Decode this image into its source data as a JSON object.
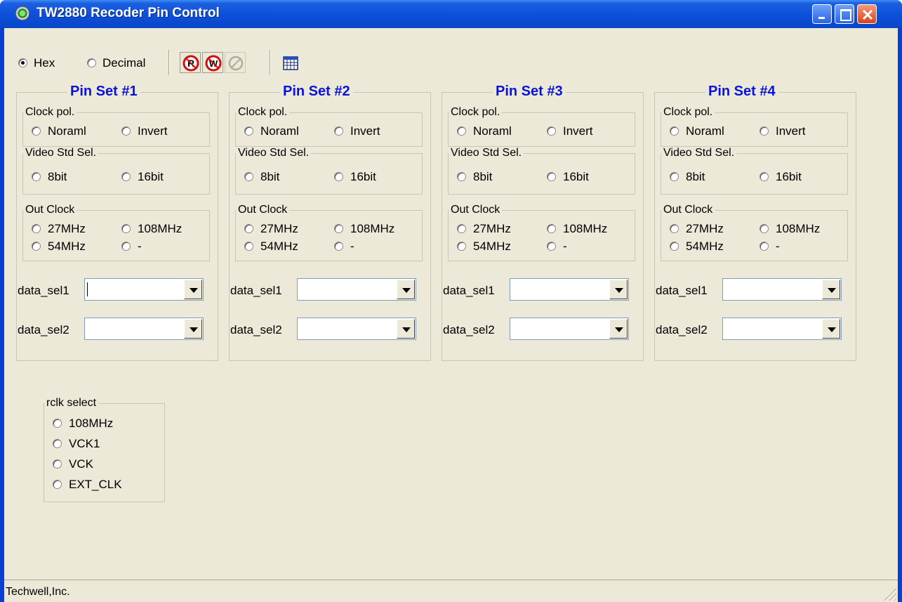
{
  "window": {
    "title": "TW2880 Recoder Pin Control"
  },
  "toolbar": {
    "radios": [
      {
        "label": "Hex",
        "checked": true
      },
      {
        "label": "Decimal",
        "checked": false
      }
    ],
    "buttons": [
      "read-icon",
      "write-icon",
      "disabled-icon",
      "table-icon"
    ]
  },
  "pinsets": [
    {
      "title": "Pin Set #1",
      "clock_pol": {
        "legend": "Clock pol.",
        "options": [
          "Noraml",
          "Invert"
        ]
      },
      "video_std": {
        "legend": "Video Std Sel.",
        "options": [
          "8bit",
          "16bit"
        ]
      },
      "out_clock": {
        "legend": "Out Clock",
        "options": [
          "27MHz",
          "108MHz",
          "54MHz",
          "-"
        ]
      },
      "data_sel1": {
        "label": "data_sel1",
        "value": ""
      },
      "data_sel2": {
        "label": "data_sel2",
        "value": ""
      }
    },
    {
      "title": "Pin Set #2",
      "clock_pol": {
        "legend": "Clock pol.",
        "options": [
          "Noraml",
          "Invert"
        ]
      },
      "video_std": {
        "legend": "Video Std Sel.",
        "options": [
          "8bit",
          "16bit"
        ]
      },
      "out_clock": {
        "legend": "Out Clock",
        "options": [
          "27MHz",
          "108MHz",
          "54MHz",
          "-"
        ]
      },
      "data_sel1": {
        "label": "data_sel1",
        "value": ""
      },
      "data_sel2": {
        "label": "data_sel2",
        "value": ""
      }
    },
    {
      "title": "Pin Set #3",
      "clock_pol": {
        "legend": "Clock pol.",
        "options": [
          "Noraml",
          "Invert"
        ]
      },
      "video_std": {
        "legend": "Video Std Sel.",
        "options": [
          "8bit",
          "16bit"
        ]
      },
      "out_clock": {
        "legend": "Out Clock",
        "options": [
          "27MHz",
          "108MHz",
          "54MHz",
          "-"
        ]
      },
      "data_sel1": {
        "label": "data_sel1",
        "value": ""
      },
      "data_sel2": {
        "label": "data_sel2",
        "value": ""
      }
    },
    {
      "title": "Pin Set #4",
      "clock_pol": {
        "legend": "Clock pol.",
        "options": [
          "Noraml",
          "Invert"
        ]
      },
      "video_std": {
        "legend": "Video Std Sel.",
        "options": [
          "8bit",
          "16bit"
        ]
      },
      "out_clock": {
        "legend": "Out Clock",
        "options": [
          "27MHz",
          "108MHz",
          "54MHz",
          "-"
        ]
      },
      "data_sel1": {
        "label": "data_sel1",
        "value": ""
      },
      "data_sel2": {
        "label": "data_sel2",
        "value": ""
      }
    }
  ],
  "rclk": {
    "legend": "rclk select",
    "options": [
      "108MHz",
      "VCK1",
      "VCK",
      "EXT_CLK"
    ]
  },
  "status": {
    "text": "Techwell,Inc."
  },
  "colors": {
    "title_blue": "#0a46c8",
    "pinset_title": "#0a14d8",
    "face": "#ece9d8",
    "close_red": "#d7441c"
  }
}
